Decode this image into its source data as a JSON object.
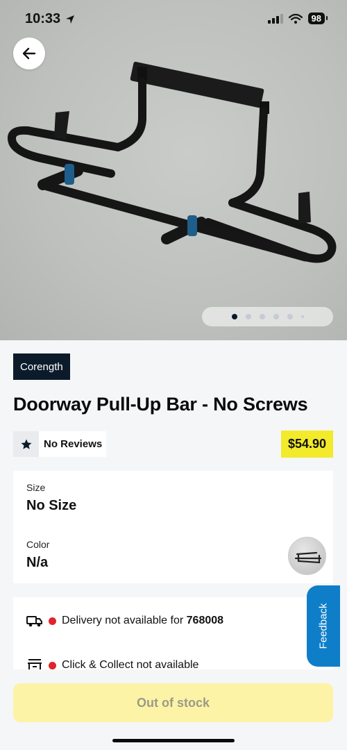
{
  "status_bar": {
    "time": "10:33",
    "battery": "98"
  },
  "gallery": {
    "total_images": 6,
    "current_index": 1
  },
  "product": {
    "brand": "Corength",
    "title": "Doorway Pull-Up Bar - No Screws",
    "reviews_label": "No Reviews",
    "price": "$54.90"
  },
  "options": {
    "size_label": "Size",
    "size_value": "No Size",
    "color_label": "Color",
    "color_value": "N/a"
  },
  "delivery": {
    "home_prefix": "Delivery not available for ",
    "postcode": "768008",
    "click_collect": "Click & Collect not available"
  },
  "feedback_label": "Feedback",
  "cta": {
    "label": "Out of stock"
  },
  "colors": {
    "brand_tag_bg": "#0c1b2a",
    "price_bg": "#f2ea2b",
    "cta_bg": "#fdf3a7",
    "feedback_bg": "#0f7ec9",
    "status_red": "#e0242b"
  }
}
